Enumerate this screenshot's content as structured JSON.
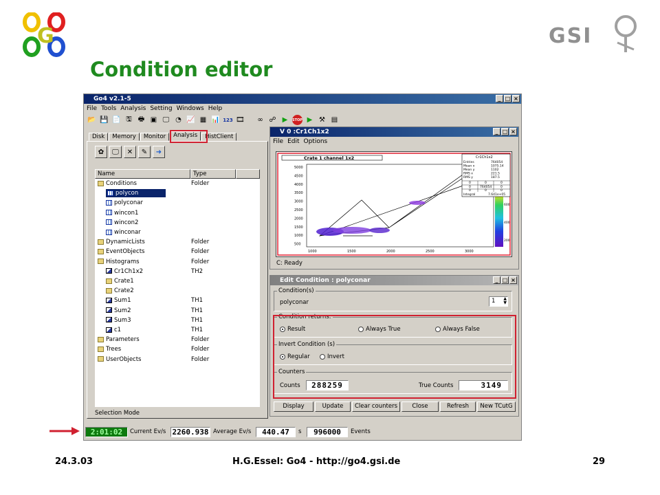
{
  "slide": {
    "title": "Condition editor",
    "footer_left": "24.3.03",
    "footer_center": "H.G.Essel: Go4 - http://go4.gsi.de",
    "footer_right": "29",
    "gsi_logo_text": "GSI",
    "go4_logo_text": "GO4"
  },
  "app": {
    "title": "Go4 v2.1-5",
    "menu": [
      "File",
      "Tools",
      "Analysis",
      "Setting",
      "Windows",
      "Help"
    ]
  },
  "browser": {
    "tabs": [
      "Disk",
      "Memory",
      "Monitor",
      "Analysis",
      "HistClient"
    ],
    "active_tab": "Analysis",
    "columns": [
      "Name",
      "Type"
    ],
    "status": "Selection Mode",
    "rows": [
      {
        "name": "Conditions",
        "type": "Folder",
        "icon": "folder-icon"
      },
      {
        "name": "polycon",
        "type": "",
        "icon": "polycondition-icon"
      },
      {
        "name": "polyconar",
        "type": "",
        "icon": "polycondition-icon"
      },
      {
        "name": "wincon1",
        "type": "",
        "icon": "window-condition-icon"
      },
      {
        "name": "wincon2",
        "type": "",
        "icon": "window-condition-icon"
      },
      {
        "name": "winconar",
        "type": "",
        "icon": "window-condition-icon"
      },
      {
        "name": "DynamicLists",
        "type": "Folder",
        "icon": "folder-icon"
      },
      {
        "name": "EventObjects",
        "type": "Folder",
        "icon": "folder-icon"
      },
      {
        "name": "Histograms",
        "type": "Folder",
        "icon": "folder-icon"
      },
      {
        "name": "Cr1Ch1x2",
        "type": "TH2",
        "icon": "histogram2d-icon"
      },
      {
        "name": "Crate1",
        "type": "",
        "icon": "folder-icon"
      },
      {
        "name": "Crate2",
        "type": "",
        "icon": "folder-icon"
      },
      {
        "name": "Sum1",
        "type": "TH1",
        "icon": "histogram1d-icon"
      },
      {
        "name": "Sum2",
        "type": "TH1",
        "icon": "histogram1d-icon"
      },
      {
        "name": "Sum3",
        "type": "TH1",
        "icon": "histogram1d-icon"
      },
      {
        "name": "c1",
        "type": "TH1",
        "icon": "histogram1d-icon"
      },
      {
        "name": "Parameters",
        "type": "Folder",
        "icon": "folder-icon"
      },
      {
        "name": "Trees",
        "type": "Folder",
        "icon": "folder-icon"
      },
      {
        "name": "UserObjects",
        "type": "Folder",
        "icon": "folder-icon"
      }
    ]
  },
  "viewer": {
    "title": "V 0 :Cr1Ch1x2",
    "menu": [
      "File",
      "Edit",
      "Options"
    ],
    "plot_title": "Crate 1 channel 1x2",
    "status": "C: Ready",
    "stats_title": "Cr1Ch1x2",
    "stats": [
      {
        "k": "Entries",
        "v": "764054"
      },
      {
        "k": "Mean x",
        "v": "1075.14"
      },
      {
        "k": "Mean y",
        "v": "1102"
      },
      {
        "k": "RMS x",
        "v": "221.5"
      },
      {
        "k": "RMS y",
        "v": "187.5"
      }
    ],
    "stats_integral_label": "Integral",
    "stats_integral": "7.641e+05",
    "stats_center": "764054",
    "y_ticks": [
      "5000",
      "4500",
      "4000",
      "3500",
      "3000",
      "2500",
      "2000",
      "1500",
      "1000",
      "500"
    ],
    "x_ticks": [
      "1000",
      "1500",
      "2000",
      "2500",
      "3000"
    ],
    "z_ticks": [
      "600",
      "400",
      "200"
    ],
    "zero": "0"
  },
  "editor": {
    "title": "Edit Condition : polyconar",
    "conditions_label": "Condition(s)",
    "condition_name": "polyconar",
    "spin_value": "1",
    "returns_label": "Condition returns:",
    "returns": [
      "Result",
      "Always True",
      "Always False"
    ],
    "returns_selected": "Result",
    "invert_label": "Invert Condition (s)",
    "invert": [
      "Regular",
      "Invert"
    ],
    "invert_selected": "Regular",
    "counters_label": "Counters",
    "counts_label": "Counts",
    "counts_value": "288259",
    "true_counts_label": "True Counts",
    "true_counts_value": "3149",
    "buttons": [
      "Display",
      "Update",
      "Clear counters",
      "Close",
      "Refresh",
      "New TCutG"
    ]
  },
  "statusbar": {
    "time": "2:01:02",
    "current_label": "Current Ev/s",
    "current_value": "2260.938",
    "average_label": "Average Ev/s",
    "average_value": "440.47",
    "seconds_label": "s",
    "events_value": "996000",
    "events_label": "Events"
  },
  "colors": {
    "title_green": "#1f8a1f",
    "highlight_red": "#d02030",
    "selection_blue": "#0a246a"
  }
}
